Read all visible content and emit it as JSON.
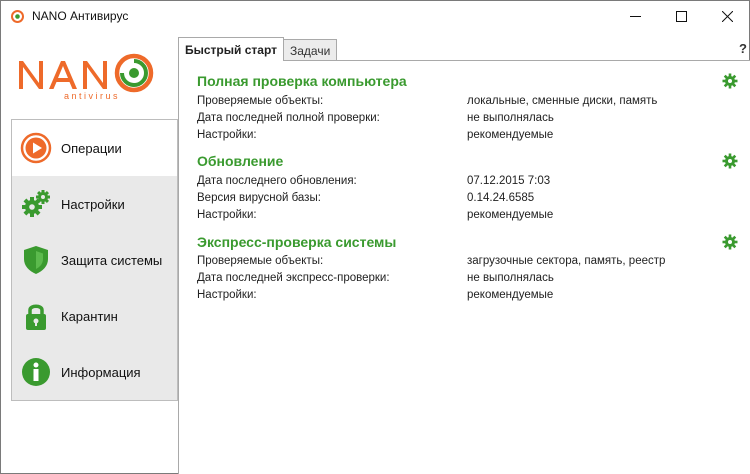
{
  "window": {
    "title": "NANO Антивирус",
    "minimize_glyph": "—",
    "maximize_glyph": "☐",
    "close_glyph": "✕"
  },
  "logo": {
    "brand": "NANO",
    "sub": "antivirus",
    "color_orange": "#ee6a2a",
    "color_green": "#3a9a2f"
  },
  "nav": {
    "items": [
      {
        "label": "Операции",
        "icon": "play-circle-icon"
      },
      {
        "label": "Настройки",
        "icon": "gears-icon"
      },
      {
        "label": "Защита системы",
        "icon": "shield-icon"
      },
      {
        "label": "Карантин",
        "icon": "lock-icon"
      },
      {
        "label": "Информация",
        "icon": "info-icon"
      }
    ]
  },
  "tabs": [
    {
      "label": "Быстрый старт",
      "active": true
    },
    {
      "label": "Задачи",
      "active": false
    }
  ],
  "help_label": "?",
  "sections": [
    {
      "title": "Полная проверка компьютера",
      "rows": [
        {
          "label": "Проверяемые объекты:",
          "value": "локальные, сменные диски, память"
        },
        {
          "label": "Дата последней полной проверки:",
          "value": "не выполнялась"
        },
        {
          "label": "Настройки:",
          "value": "рекомендуемые"
        }
      ]
    },
    {
      "title": "Обновление",
      "rows": [
        {
          "label": "Дата последнего обновления:",
          "value": "07.12.2015 7:03"
        },
        {
          "label": "Версия вирусной базы:",
          "value": "0.14.24.6585"
        },
        {
          "label": "Настройки:",
          "value": "рекомендуемые"
        }
      ]
    },
    {
      "title": "Экспресс-проверка системы",
      "rows": [
        {
          "label": "Проверяемые объекты:",
          "value": "загрузочные сектора, память, реестр"
        },
        {
          "label": "Дата последней экспресс-проверки:",
          "value": "не выполнялась"
        },
        {
          "label": "Настройки:",
          "value": "рекомендуемые"
        }
      ]
    }
  ],
  "colors": {
    "accent_green": "#3a9a2f",
    "accent_orange": "#ee6a2a",
    "nav_bg": "#e9e9e9"
  }
}
